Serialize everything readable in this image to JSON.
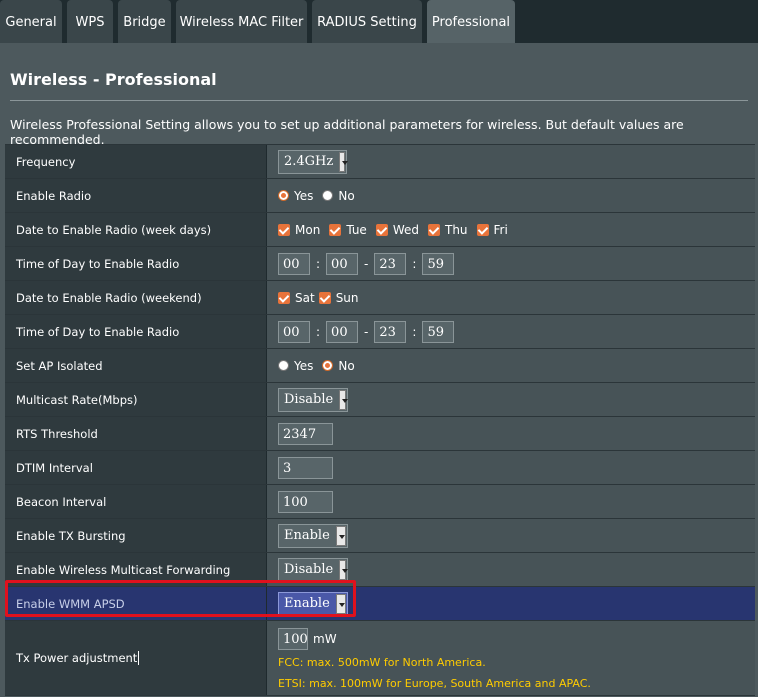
{
  "tabs": [
    "General",
    "WPS",
    "Bridge",
    "Wireless MAC Filter",
    "RADIUS Setting",
    "Professional"
  ],
  "page_title": "Wireless - Professional",
  "description": "Wireless Professional Setting allows you to set up additional parameters for wireless. But default values are recommended.",
  "rows": {
    "frequency": {
      "label": "Frequency",
      "value": "2.4GHz"
    },
    "enable_radio": {
      "label": "Enable Radio",
      "yes": "Yes",
      "no": "No",
      "selected": "Yes"
    },
    "date_weekdays": {
      "label": "Date to Enable Radio (week days)",
      "days": [
        "Mon",
        "Tue",
        "Wed",
        "Thu",
        "Fri"
      ]
    },
    "time_weekdays": {
      "label": "Time of Day to Enable Radio",
      "start_h": "00",
      "start_m": "00",
      "end_h": "23",
      "end_m": "59",
      "colon": ":",
      "dash": "-"
    },
    "date_weekend": {
      "label": "Date to Enable Radio (weekend)",
      "days": [
        "Sat",
        "Sun"
      ]
    },
    "time_weekend": {
      "label": "Time of Day to Enable Radio",
      "start_h": "00",
      "start_m": "00",
      "end_h": "23",
      "end_m": "59",
      "colon": ":",
      "dash": "-"
    },
    "ap_isolated": {
      "label": "Set AP Isolated",
      "yes": "Yes",
      "no": "No",
      "selected": "No"
    },
    "multicast_rate": {
      "label": "Multicast Rate(Mbps)",
      "value": "Disable"
    },
    "rts": {
      "label": "RTS Threshold",
      "value": "2347"
    },
    "dtim": {
      "label": "DTIM Interval",
      "value": "3"
    },
    "beacon": {
      "label": "Beacon Interval",
      "value": "100"
    },
    "tx_bursting": {
      "label": "Enable TX Bursting",
      "value": "Enable"
    },
    "multicast_fwd": {
      "label": "Enable Wireless Multicast Forwarding",
      "value": "Disable"
    },
    "wmm_apsd": {
      "label": "Enable WMM APSD",
      "value": "Enable"
    },
    "tx_power": {
      "label": "Tx Power adjustment",
      "value": "100",
      "unit": "mW",
      "note_fcc": "FCC: max. 500mW for North America.",
      "note_etsi": "ETSI: max. 100mW for Europe, South America and APAC."
    }
  },
  "colors": {
    "accent_orange": "#e8733a",
    "highlight": "#283570",
    "red_outline": "#e0111d",
    "note": "#ffcc00"
  }
}
